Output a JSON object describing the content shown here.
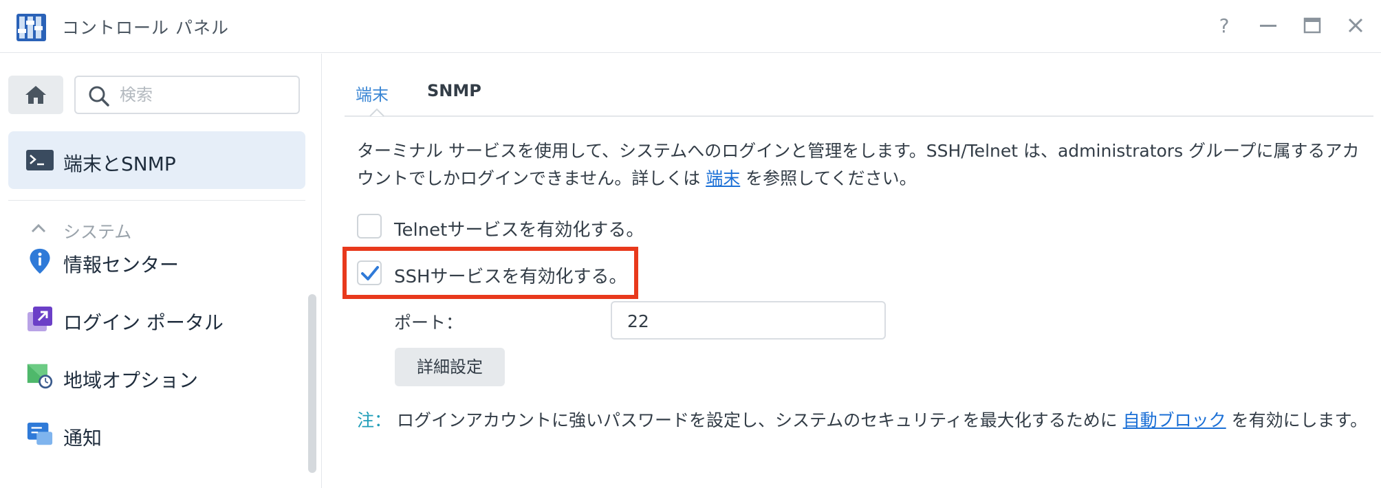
{
  "window": {
    "title": "コントロール パネル",
    "help_label": "?"
  },
  "sidebar": {
    "search_placeholder": "検索",
    "active_item": "端末とSNMP",
    "section": "システム",
    "items": [
      {
        "label": "情報センター",
        "icon": "info-icon"
      },
      {
        "label": "ログイン ポータル",
        "icon": "login-portal-icon"
      },
      {
        "label": "地域オプション",
        "icon": "regional-options-icon"
      },
      {
        "label": "通知",
        "icon": "notification-icon"
      }
    ]
  },
  "tabs": [
    {
      "label": "端末",
      "active": true
    },
    {
      "label": "SNMP",
      "active": false
    }
  ],
  "main": {
    "description_part1": "ターミナル サービスを使用して、システムへのログインと管理をします。SSH/Telnet は、administrators グループに属するアカウントでしかログインできません。詳しくは ",
    "description_link": "端末",
    "description_part2": " を参照してください。",
    "telnet": {
      "label": "Telnetサービスを有効化する。",
      "checked": false
    },
    "ssh": {
      "label": "SSHサービスを有効化する。",
      "checked": true
    },
    "port_label": "ポート：",
    "port_value": "22",
    "advanced_button": "詳細設定",
    "note_label": "注：",
    "note_part1": " ログインアカウントに強いパスワードを設定し、システムのセキュリティを最大化するために ",
    "note_link": "自動ブロック",
    "note_part2": " を有効にします。"
  },
  "colors": {
    "accent": "#3a86d4",
    "link": "#1a6fd6",
    "highlight": "#e8391c",
    "note": "#1f9db8"
  }
}
